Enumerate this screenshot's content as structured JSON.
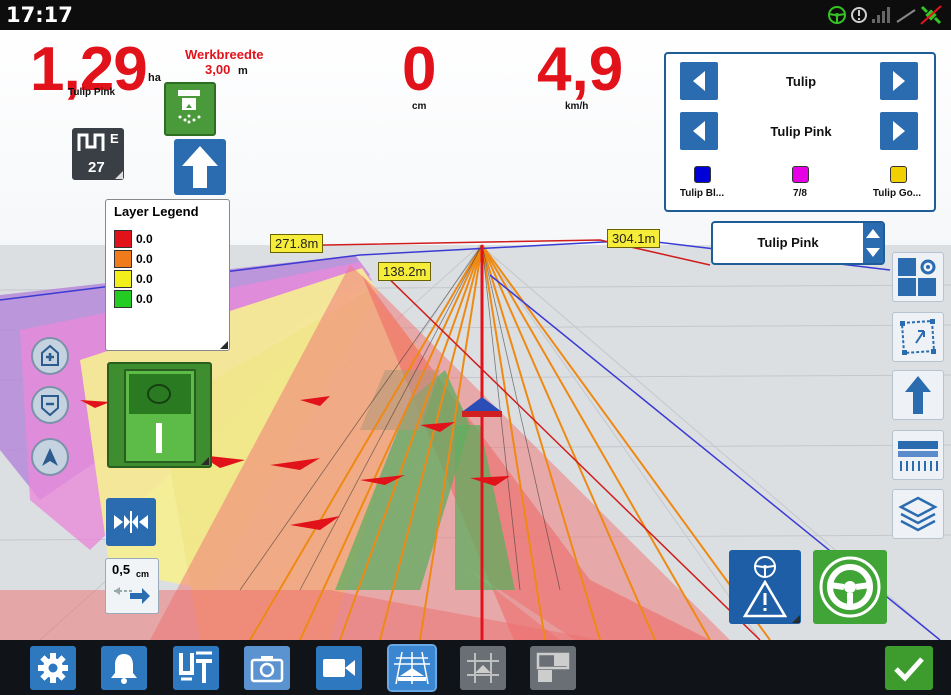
{
  "status": {
    "time": "17:17"
  },
  "stats": {
    "area_value": "1,29",
    "area_unit": "ha",
    "product": "Tulip Pink",
    "width_title": "Werkbreedte",
    "width_value": "3,00",
    "width_unit": "m",
    "offset_value": "0",
    "offset_unit": "cm",
    "speed_value": "4,9",
    "speed_unit": "km/h"
  },
  "guidance": {
    "mode_letter": "E",
    "mode_number": "27"
  },
  "product_panel": {
    "row1": "Tulip",
    "row2": "Tulip Pink",
    "swatches": [
      {
        "label": "Tulip Bl...",
        "color": "#0000d8"
      },
      {
        "label": "7/8",
        "color": "#e600e6"
      },
      {
        "label": "Tulip Go...",
        "color": "#f0d000"
      }
    ]
  },
  "product_select": {
    "value": "Tulip Pink"
  },
  "legend": {
    "title": "Layer Legend",
    "items": [
      {
        "color": "#e2121b",
        "value": "0.0"
      },
      {
        "color": "#ef7b1a",
        "value": "0.0"
      },
      {
        "color": "#f3ef1a",
        "value": "0.0"
      },
      {
        "color": "#22cc22",
        "value": "0.0"
      }
    ]
  },
  "distances": [
    "271.8m",
    "138.2m",
    "304.1m"
  ],
  "nudge": {
    "value": "0,5",
    "unit": "cm"
  },
  "colors": {
    "red": "#e2121b",
    "blue": "#2b6cb0",
    "green": "#3e9c2f"
  }
}
